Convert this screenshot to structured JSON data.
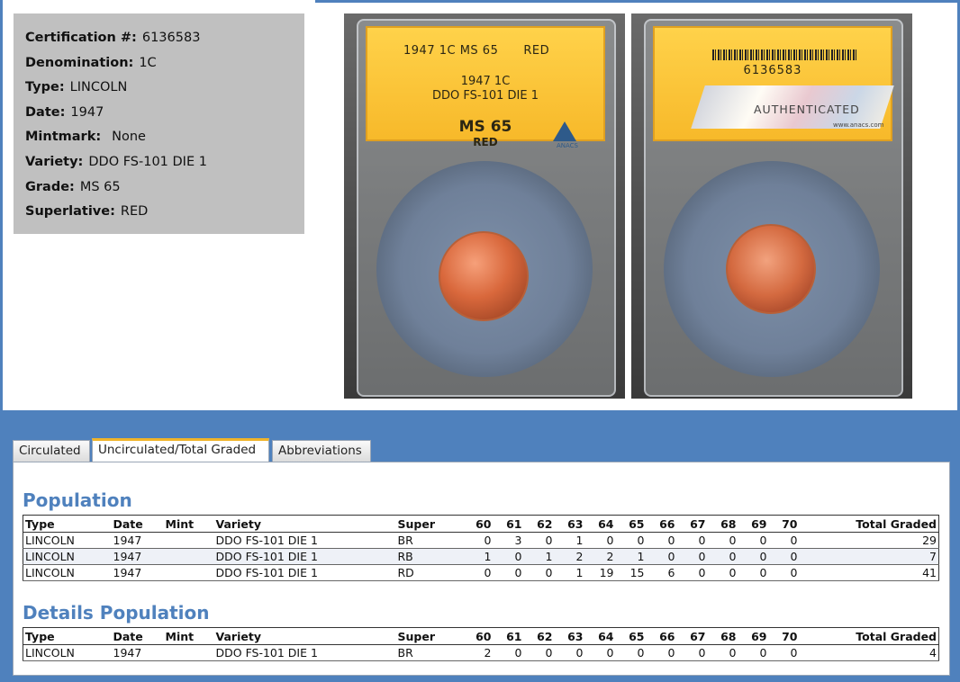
{
  "info": {
    "rows": [
      {
        "label": "Certification #:",
        "value": "6136583"
      },
      {
        "label": "Denomination:",
        "value": "1C"
      },
      {
        "label": "Type:",
        "value": "LINCOLN"
      },
      {
        "label": "Date:",
        "value": "1947"
      },
      {
        "label": "Mintmark:",
        "value": "None"
      },
      {
        "label": "Variety:",
        "value": "DDO FS-101 DIE 1"
      },
      {
        "label": "Grade:",
        "value": "MS 65"
      },
      {
        "label": "Superlative:",
        "value": "RED"
      }
    ]
  },
  "slab_front": {
    "top_left": "1947 1C MS 65",
    "top_right": "RED",
    "line1": "1947 1C",
    "line2": "DDO  FS-101  DIE 1",
    "grade": "MS 65",
    "superlative": "RED",
    "brand": "ANACS"
  },
  "slab_back": {
    "cert": "6136583",
    "hologram_text": "AUTHENTICATED",
    "url": "www.anacs.com"
  },
  "tabs": [
    {
      "label": "Circulated",
      "active": false
    },
    {
      "label": "Uncirculated/Total Graded",
      "active": true
    },
    {
      "label": "Abbreviations",
      "active": false
    }
  ],
  "columns": [
    "Type",
    "Date",
    "Mint",
    "Variety",
    "Super",
    "60",
    "61",
    "62",
    "63",
    "64",
    "65",
    "66",
    "67",
    "68",
    "69",
    "70",
    "Total Graded"
  ],
  "population": {
    "title": "Population",
    "rows": [
      {
        "type": "LINCOLN",
        "date": "1947",
        "mint": "",
        "variety": "DDO FS-101 DIE 1",
        "super": "BR",
        "g60": "0",
        "g61": "3",
        "g62": "0",
        "g63": "1",
        "g64": "0",
        "g65": "0",
        "g66": "0",
        "g67": "0",
        "g68": "0",
        "g69": "0",
        "g70": "0",
        "total": "29"
      },
      {
        "type": "LINCOLN",
        "date": "1947",
        "mint": "",
        "variety": "DDO FS-101 DIE 1",
        "super": "RB",
        "g60": "1",
        "g61": "0",
        "g62": "1",
        "g63": "2",
        "g64": "2",
        "g65": "1",
        "g66": "0",
        "g67": "0",
        "g68": "0",
        "g69": "0",
        "g70": "0",
        "total": "7"
      },
      {
        "type": "LINCOLN",
        "date": "1947",
        "mint": "",
        "variety": "DDO FS-101 DIE 1",
        "super": "RD",
        "g60": "0",
        "g61": "0",
        "g62": "0",
        "g63": "1",
        "g64": "19",
        "g65": "15",
        "g66": "6",
        "g67": "0",
        "g68": "0",
        "g69": "0",
        "g70": "0",
        "total": "41"
      }
    ]
  },
  "details": {
    "title": "Details Population",
    "rows": [
      {
        "type": "LINCOLN",
        "date": "1947",
        "mint": "",
        "variety": "DDO FS-101 DIE 1",
        "super": "BR",
        "g60": "2",
        "g61": "0",
        "g62": "0",
        "g63": "0",
        "g64": "0",
        "g65": "0",
        "g66": "0",
        "g67": "0",
        "g68": "0",
        "g69": "0",
        "g70": "0",
        "total": "4"
      }
    ]
  },
  "colors": {
    "accent_blue": "#4f81bd",
    "active_tab_marker": "#f0b429",
    "info_box_bg": "#c0c0c0"
  }
}
